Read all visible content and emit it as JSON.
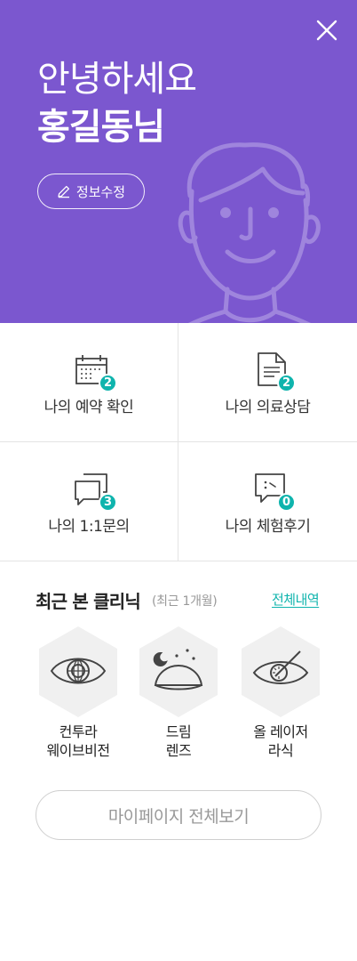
{
  "header": {
    "greeting": "안녕하세요",
    "username": "홍길동님",
    "edit_label": "정보수정",
    "close_icon": "close-icon",
    "background_color": "#7b57cf"
  },
  "menu": [
    {
      "icon": "calendar-icon",
      "label": "나의 예약 확인",
      "count": "2"
    },
    {
      "icon": "document-icon",
      "label": "나의 의료상담",
      "count": "2"
    },
    {
      "icon": "chat-bubbles-icon",
      "label": "나의 1:1문의",
      "count": "3"
    },
    {
      "icon": "review-bubble-icon",
      "label": "나의 체험후기",
      "count": "0"
    }
  ],
  "recent": {
    "title": "최근 본 클리닉",
    "subtitle": "(최근 1개월)",
    "view_all": "전체내역",
    "items": [
      {
        "icon": "eye-globe-icon",
        "line1": "컨투라",
        "line2": "웨이브비전"
      },
      {
        "icon": "night-lens-icon",
        "line1": "드림",
        "line2": "렌즈"
      },
      {
        "icon": "eye-laser-icon",
        "line1": "올 레이저",
        "line2": "라식"
      }
    ]
  },
  "mypage_button": "마이페이지 전체보기",
  "colors": {
    "accent": "#7b57cf",
    "badge": "#0fb4ad",
    "link": "#0fb4ad"
  }
}
